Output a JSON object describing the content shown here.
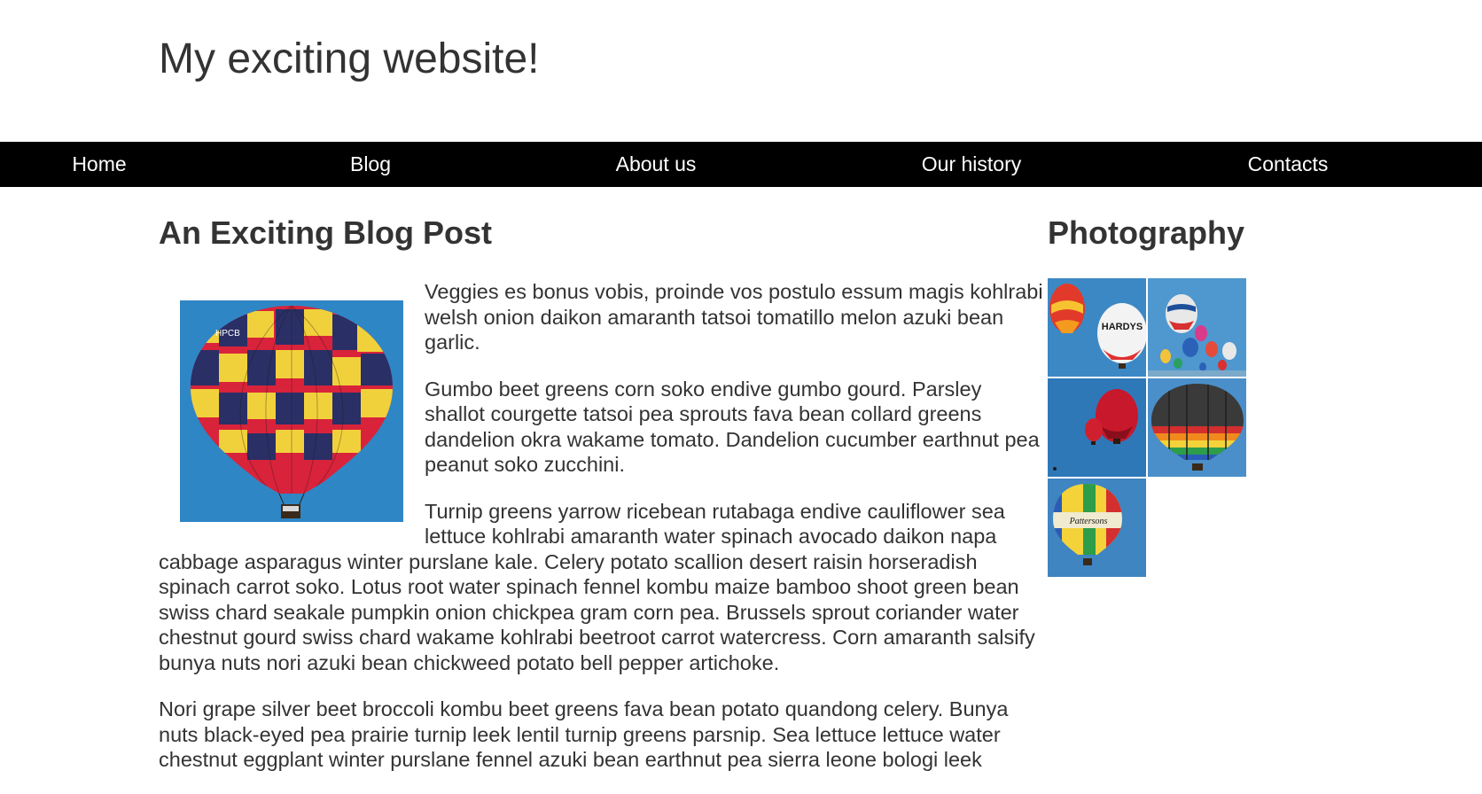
{
  "site": {
    "title": "My exciting website!"
  },
  "nav": {
    "items": [
      {
        "label": "Home"
      },
      {
        "label": "Blog"
      },
      {
        "label": "About us"
      },
      {
        "label": "Our history"
      },
      {
        "label": "Contacts"
      }
    ]
  },
  "post": {
    "title": "An Exciting Blog Post",
    "image_icon": "hot-air-balloon-photo",
    "paragraphs": [
      "Veggies es bonus vobis, proinde vos postulo essum magis kohlrabi welsh onion daikon amaranth tatsoi tomatillo melon azuki bean garlic.",
      "Gumbo beet greens corn soko endive gumbo gourd. Parsley shallot courgette tatsoi pea sprouts fava bean collard greens dandelion okra wakame tomato. Dandelion cucumber earthnut pea peanut soko zucchini.",
      "Turnip greens yarrow ricebean rutabaga endive cauliflower sea lettuce kohlrabi amaranth water spinach avocado daikon napa cabbage asparagus winter purslane kale. Celery potato scallion desert raisin horseradish spinach carrot soko. Lotus root water spinach fennel kombu maize bamboo shoot green bean swiss chard seakale pumpkin onion chickpea gram corn pea. Brussels sprout coriander water chestnut gourd swiss chard wakame kohlrabi beetroot carrot watercress. Corn amaranth salsify bunya nuts nori azuki bean chickweed potato bell pepper artichoke.",
      "Nori grape silver beet broccoli kombu beet greens fava bean potato quandong celery. Bunya nuts black-eyed pea prairie turnip leek lentil turnip greens parsnip. Sea lettuce lettuce water chestnut eggplant winter purslane fennel azuki bean earthnut pea sierra leone bologi leek"
    ]
  },
  "sidebar": {
    "title": "Photography",
    "photos": [
      {
        "icon": "balloon-photo-1"
      },
      {
        "icon": "balloon-photo-2"
      },
      {
        "icon": "balloon-photo-3"
      },
      {
        "icon": "balloon-photo-4"
      },
      {
        "icon": "balloon-photo-5"
      }
    ],
    "logo_text": {
      "hardys": "HARDYS",
      "pattersons": "Pattersons"
    }
  },
  "colors": {
    "nav_background": "#000000",
    "nav_text": "#ffffff",
    "text": "#333333",
    "sky_blue": "#2f86c5"
  }
}
